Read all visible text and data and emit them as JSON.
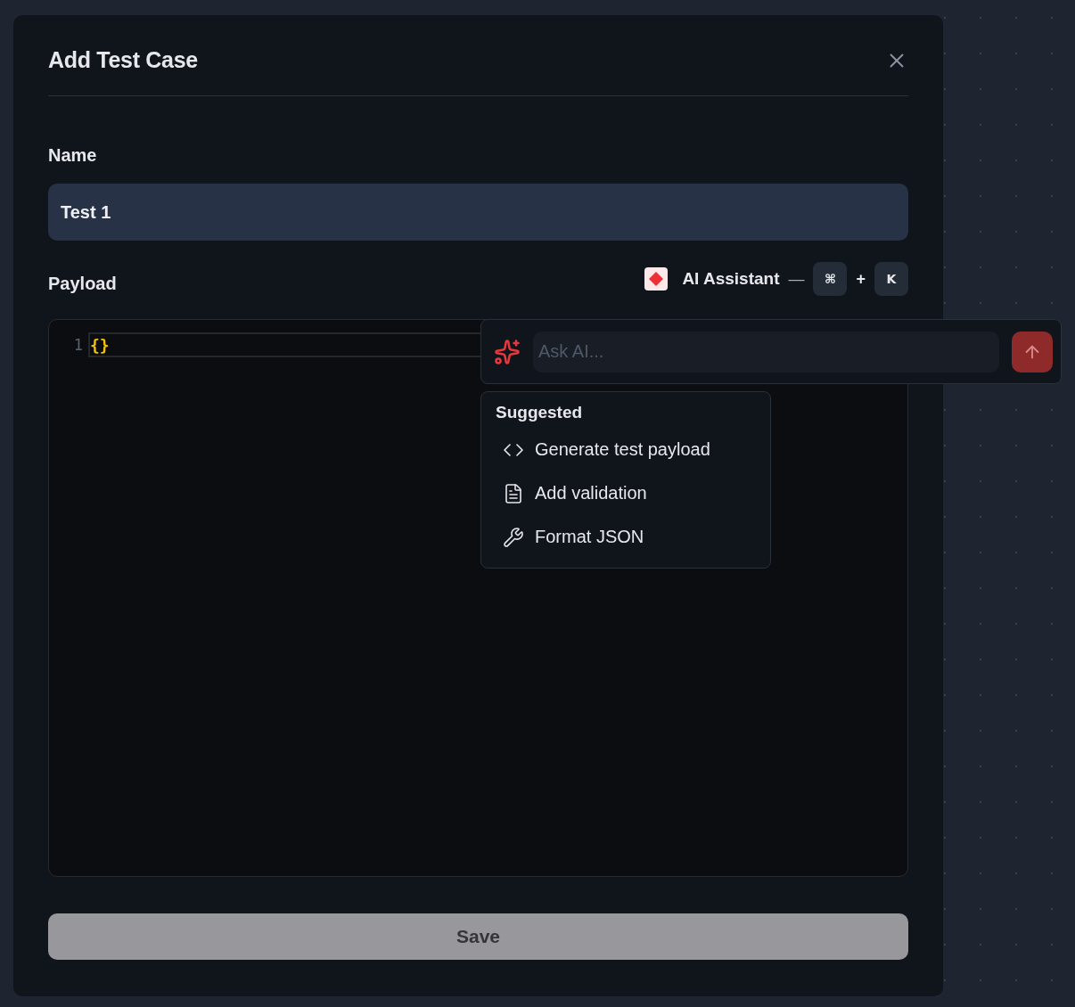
{
  "dialog": {
    "title": "Add Test Case"
  },
  "name_field": {
    "label": "Name",
    "value": "Test 1"
  },
  "payload": {
    "label": "Payload",
    "ai_assistant": {
      "label": "AI Assistant",
      "separator": "—",
      "keys": [
        "⌘",
        "K"
      ],
      "joiner": "+"
    },
    "editor": {
      "lines": [
        {
          "number": "1",
          "code": "{}"
        }
      ]
    }
  },
  "ai_prompt": {
    "placeholder": "Ask AI..."
  },
  "suggestions": {
    "heading": "Suggested",
    "items": [
      {
        "kind": "code",
        "label": "Generate test payload"
      },
      {
        "kind": "document",
        "label": "Add validation"
      },
      {
        "kind": "wrench",
        "label": "Format JSON"
      }
    ]
  },
  "save_button": "Save"
}
